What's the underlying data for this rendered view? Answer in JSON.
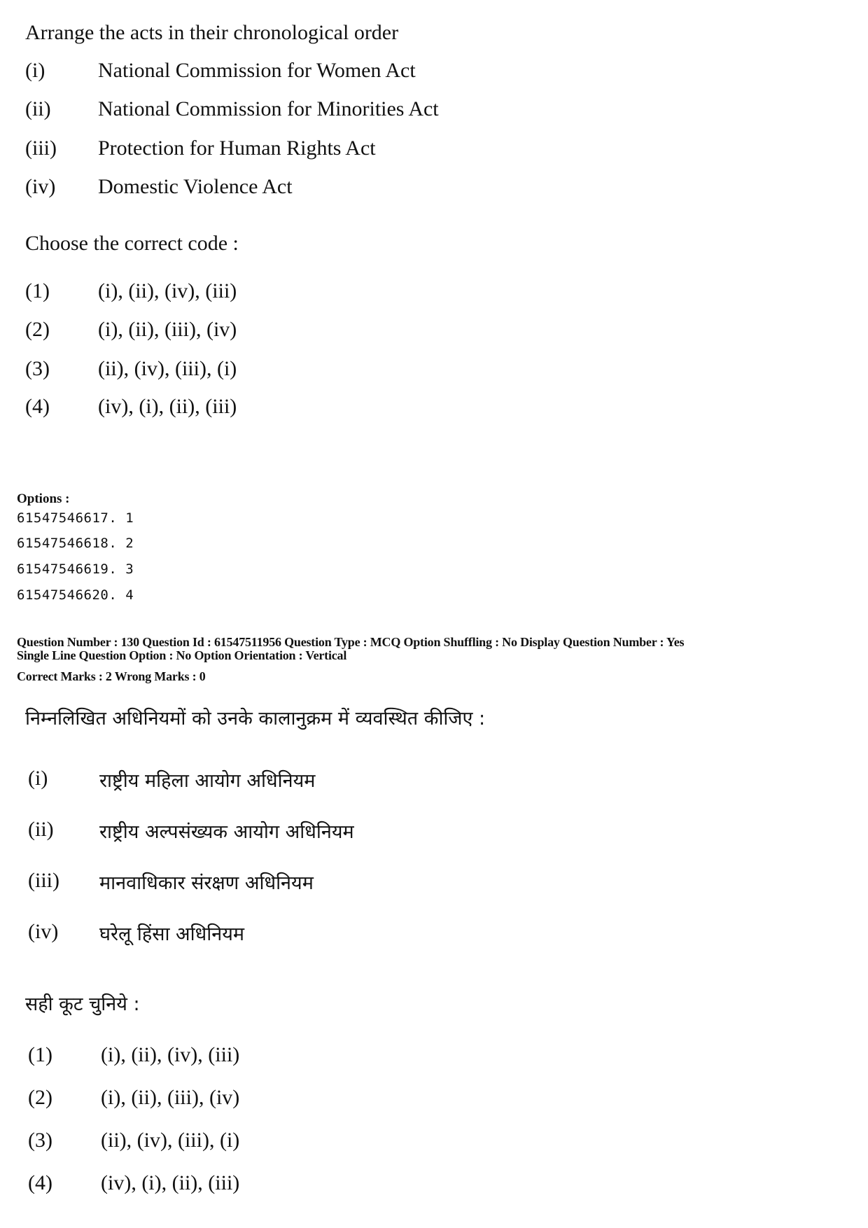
{
  "english": {
    "question": "Arrange the acts in their chronological order",
    "items": [
      {
        "num": "(i)",
        "text": "National Commission for Women Act"
      },
      {
        "num": "(ii)",
        "text": "National Commission for Minorities Act"
      },
      {
        "num": "(iii)",
        "text": "Protection for Human Rights Act"
      },
      {
        "num": "(iv)",
        "text": "Domestic Violence Act"
      }
    ],
    "choose_label": "Choose the correct code :",
    "codes": [
      {
        "num": "(1)",
        "text": "(i),  (ii), (iv), (iii)"
      },
      {
        "num": "(2)",
        "text": "(i), (ii), (iii), (iv)"
      },
      {
        "num": "(3)",
        "text": "(ii), (iv), (iii), (i)"
      },
      {
        "num": "(4)",
        "text": "(iv), (i), (ii), (iii)"
      }
    ]
  },
  "options": {
    "label": "Options :",
    "items": [
      "61547546617. 1",
      "61547546618. 2",
      "61547546619. 3",
      "61547546620. 4"
    ]
  },
  "meta": {
    "line1": "Question Number : 130  Question Id : 61547511956  Question Type : MCQ  Option Shuffling : No  Display Question Number : Yes",
    "line2": "Single Line Question Option : No  Option Orientation : Vertical",
    "line3": "Correct Marks : 2  Wrong Marks : 0"
  },
  "hindi": {
    "question": "निम्नलिखित अधिनियमों को उनके कालानुक्रम में व्यवस्थित कीजिए :",
    "items": [
      {
        "num": "(i)",
        "text": "राष्ट्रीय महिला आयोग अधिनियम"
      },
      {
        "num": "(ii)",
        "text": "राष्ट्रीय अल्पसंख्यक आयोग अधिनियम"
      },
      {
        "num": "(iii)",
        "text": "मानवाधिकार संरक्षण अधिनियम"
      },
      {
        "num": "(iv)",
        "text": "घरेलू हिंसा अधिनियम"
      }
    ],
    "choose_label": "सही कूट चुनिये :",
    "codes": [
      {
        "num": "(1)",
        "text": "(i),  (ii), (iv), (iii)"
      },
      {
        "num": "(2)",
        "text": "(i), (ii), (iii), (iv)"
      },
      {
        "num": "(3)",
        "text": "(ii), (iv), (iii), (i)"
      },
      {
        "num": "(4)",
        "text": "(iv), (i), (ii), (iii)"
      }
    ]
  }
}
